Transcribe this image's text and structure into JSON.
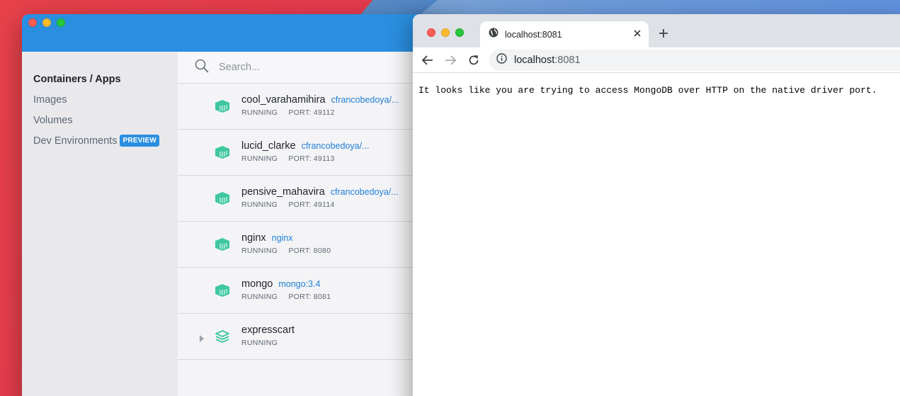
{
  "docker": {
    "sidebar": {
      "items": [
        {
          "label": "Containers / Apps",
          "active": true
        },
        {
          "label": "Images"
        },
        {
          "label": "Volumes"
        },
        {
          "label": "Dev Environments",
          "badge": "PREVIEW"
        }
      ]
    },
    "search": {
      "placeholder": "Search..."
    },
    "containers": [
      {
        "name": "cool_varahamihira",
        "image": "cfrancobedoya/...",
        "status": "RUNNING",
        "port": "PORT: 49112",
        "icon": "container-icon"
      },
      {
        "name": "lucid_clarke",
        "image": "cfrancobedoya/...",
        "status": "RUNNING",
        "port": "PORT: 49113",
        "icon": "container-icon"
      },
      {
        "name": "pensive_mahavira",
        "image": "cfrancobedoya/...",
        "status": "RUNNING",
        "port": "PORT: 49114",
        "icon": "container-icon"
      },
      {
        "name": "nginx",
        "image": "nginx",
        "status": "RUNNING",
        "port": "PORT: 8080",
        "icon": "container-icon"
      },
      {
        "name": "mongo",
        "image": "mongo:3.4",
        "status": "RUNNING",
        "port": "PORT: 8081",
        "icon": "container-icon"
      },
      {
        "name": "expresscart",
        "image": "",
        "status": "RUNNING",
        "port": "",
        "icon": "stack-icon"
      }
    ],
    "colors": {
      "accent": "#2a8fe0",
      "container_icon": "#3ec7a0",
      "link": "#1f7fd6"
    }
  },
  "browser": {
    "tab": {
      "title": "localhost:8081"
    },
    "omnibox": {
      "host": "localhost",
      "port": ":8081"
    },
    "body_text": "It looks like you are trying to access MongoDB over HTTP on the native driver port."
  }
}
